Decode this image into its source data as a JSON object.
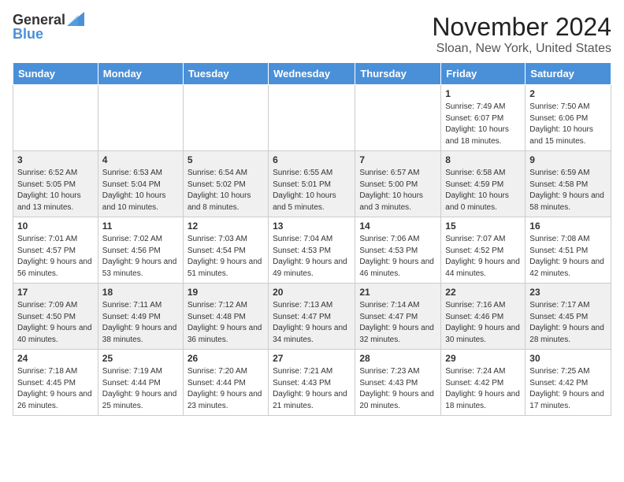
{
  "header": {
    "logo_general": "General",
    "logo_blue": "Blue",
    "month_title": "November 2024",
    "location": "Sloan, New York, United States"
  },
  "weekdays": [
    "Sunday",
    "Monday",
    "Tuesday",
    "Wednesday",
    "Thursday",
    "Friday",
    "Saturday"
  ],
  "weeks": [
    [
      {
        "day": "",
        "info": ""
      },
      {
        "day": "",
        "info": ""
      },
      {
        "day": "",
        "info": ""
      },
      {
        "day": "",
        "info": ""
      },
      {
        "day": "",
        "info": ""
      },
      {
        "day": "1",
        "info": "Sunrise: 7:49 AM\nSunset: 6:07 PM\nDaylight: 10 hours and 18 minutes."
      },
      {
        "day": "2",
        "info": "Sunrise: 7:50 AM\nSunset: 6:06 PM\nDaylight: 10 hours and 15 minutes."
      }
    ],
    [
      {
        "day": "3",
        "info": "Sunrise: 6:52 AM\nSunset: 5:05 PM\nDaylight: 10 hours and 13 minutes."
      },
      {
        "day": "4",
        "info": "Sunrise: 6:53 AM\nSunset: 5:04 PM\nDaylight: 10 hours and 10 minutes."
      },
      {
        "day": "5",
        "info": "Sunrise: 6:54 AM\nSunset: 5:02 PM\nDaylight: 10 hours and 8 minutes."
      },
      {
        "day": "6",
        "info": "Sunrise: 6:55 AM\nSunset: 5:01 PM\nDaylight: 10 hours and 5 minutes."
      },
      {
        "day": "7",
        "info": "Sunrise: 6:57 AM\nSunset: 5:00 PM\nDaylight: 10 hours and 3 minutes."
      },
      {
        "day": "8",
        "info": "Sunrise: 6:58 AM\nSunset: 4:59 PM\nDaylight: 10 hours and 0 minutes."
      },
      {
        "day": "9",
        "info": "Sunrise: 6:59 AM\nSunset: 4:58 PM\nDaylight: 9 hours and 58 minutes."
      }
    ],
    [
      {
        "day": "10",
        "info": "Sunrise: 7:01 AM\nSunset: 4:57 PM\nDaylight: 9 hours and 56 minutes."
      },
      {
        "day": "11",
        "info": "Sunrise: 7:02 AM\nSunset: 4:56 PM\nDaylight: 9 hours and 53 minutes."
      },
      {
        "day": "12",
        "info": "Sunrise: 7:03 AM\nSunset: 4:54 PM\nDaylight: 9 hours and 51 minutes."
      },
      {
        "day": "13",
        "info": "Sunrise: 7:04 AM\nSunset: 4:53 PM\nDaylight: 9 hours and 49 minutes."
      },
      {
        "day": "14",
        "info": "Sunrise: 7:06 AM\nSunset: 4:53 PM\nDaylight: 9 hours and 46 minutes."
      },
      {
        "day": "15",
        "info": "Sunrise: 7:07 AM\nSunset: 4:52 PM\nDaylight: 9 hours and 44 minutes."
      },
      {
        "day": "16",
        "info": "Sunrise: 7:08 AM\nSunset: 4:51 PM\nDaylight: 9 hours and 42 minutes."
      }
    ],
    [
      {
        "day": "17",
        "info": "Sunrise: 7:09 AM\nSunset: 4:50 PM\nDaylight: 9 hours and 40 minutes."
      },
      {
        "day": "18",
        "info": "Sunrise: 7:11 AM\nSunset: 4:49 PM\nDaylight: 9 hours and 38 minutes."
      },
      {
        "day": "19",
        "info": "Sunrise: 7:12 AM\nSunset: 4:48 PM\nDaylight: 9 hours and 36 minutes."
      },
      {
        "day": "20",
        "info": "Sunrise: 7:13 AM\nSunset: 4:47 PM\nDaylight: 9 hours and 34 minutes."
      },
      {
        "day": "21",
        "info": "Sunrise: 7:14 AM\nSunset: 4:47 PM\nDaylight: 9 hours and 32 minutes."
      },
      {
        "day": "22",
        "info": "Sunrise: 7:16 AM\nSunset: 4:46 PM\nDaylight: 9 hours and 30 minutes."
      },
      {
        "day": "23",
        "info": "Sunrise: 7:17 AM\nSunset: 4:45 PM\nDaylight: 9 hours and 28 minutes."
      }
    ],
    [
      {
        "day": "24",
        "info": "Sunrise: 7:18 AM\nSunset: 4:45 PM\nDaylight: 9 hours and 26 minutes."
      },
      {
        "day": "25",
        "info": "Sunrise: 7:19 AM\nSunset: 4:44 PM\nDaylight: 9 hours and 25 minutes."
      },
      {
        "day": "26",
        "info": "Sunrise: 7:20 AM\nSunset: 4:44 PM\nDaylight: 9 hours and 23 minutes."
      },
      {
        "day": "27",
        "info": "Sunrise: 7:21 AM\nSunset: 4:43 PM\nDaylight: 9 hours and 21 minutes."
      },
      {
        "day": "28",
        "info": "Sunrise: 7:23 AM\nSunset: 4:43 PM\nDaylight: 9 hours and 20 minutes."
      },
      {
        "day": "29",
        "info": "Sunrise: 7:24 AM\nSunset: 4:42 PM\nDaylight: 9 hours and 18 minutes."
      },
      {
        "day": "30",
        "info": "Sunrise: 7:25 AM\nSunset: 4:42 PM\nDaylight: 9 hours and 17 minutes."
      }
    ]
  ]
}
